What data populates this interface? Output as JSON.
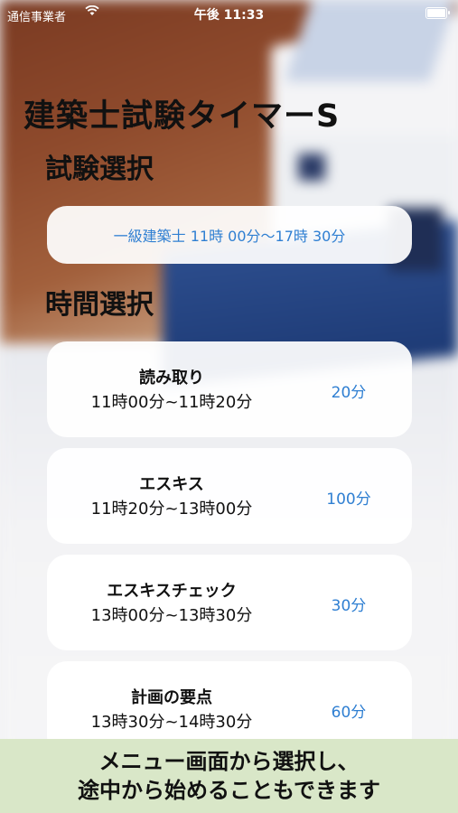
{
  "status_bar": {
    "carrier": "通信事業者",
    "time": "午後 11:33",
    "wifi_icon": "wifi-icon",
    "battery_icon": "battery-icon"
  },
  "app_title": "建築士試験タイマーS",
  "exam_section": {
    "title": "試験選択",
    "selected_exam": "一級建築士 11時 00分〜17時 30分"
  },
  "time_section": {
    "title": "時間選択",
    "items": [
      {
        "name": "読み取り",
        "range": "11時00分~11時20分",
        "duration": "20分"
      },
      {
        "name": "エスキス",
        "range": "11時20分~13時00分",
        "duration": "100分"
      },
      {
        "name": "エスキスチェック",
        "range": "13時00分~13時30分",
        "duration": "30分"
      },
      {
        "name": "計画の要点",
        "range": "13時30分~14時30分",
        "duration": "60分"
      }
    ]
  },
  "banner": {
    "line1": "メニュー画面から選択し、",
    "line2": "途中から始めることもできます"
  },
  "colors": {
    "accent": "#2f7fd2",
    "banner_bg": "#d9e7c8"
  }
}
